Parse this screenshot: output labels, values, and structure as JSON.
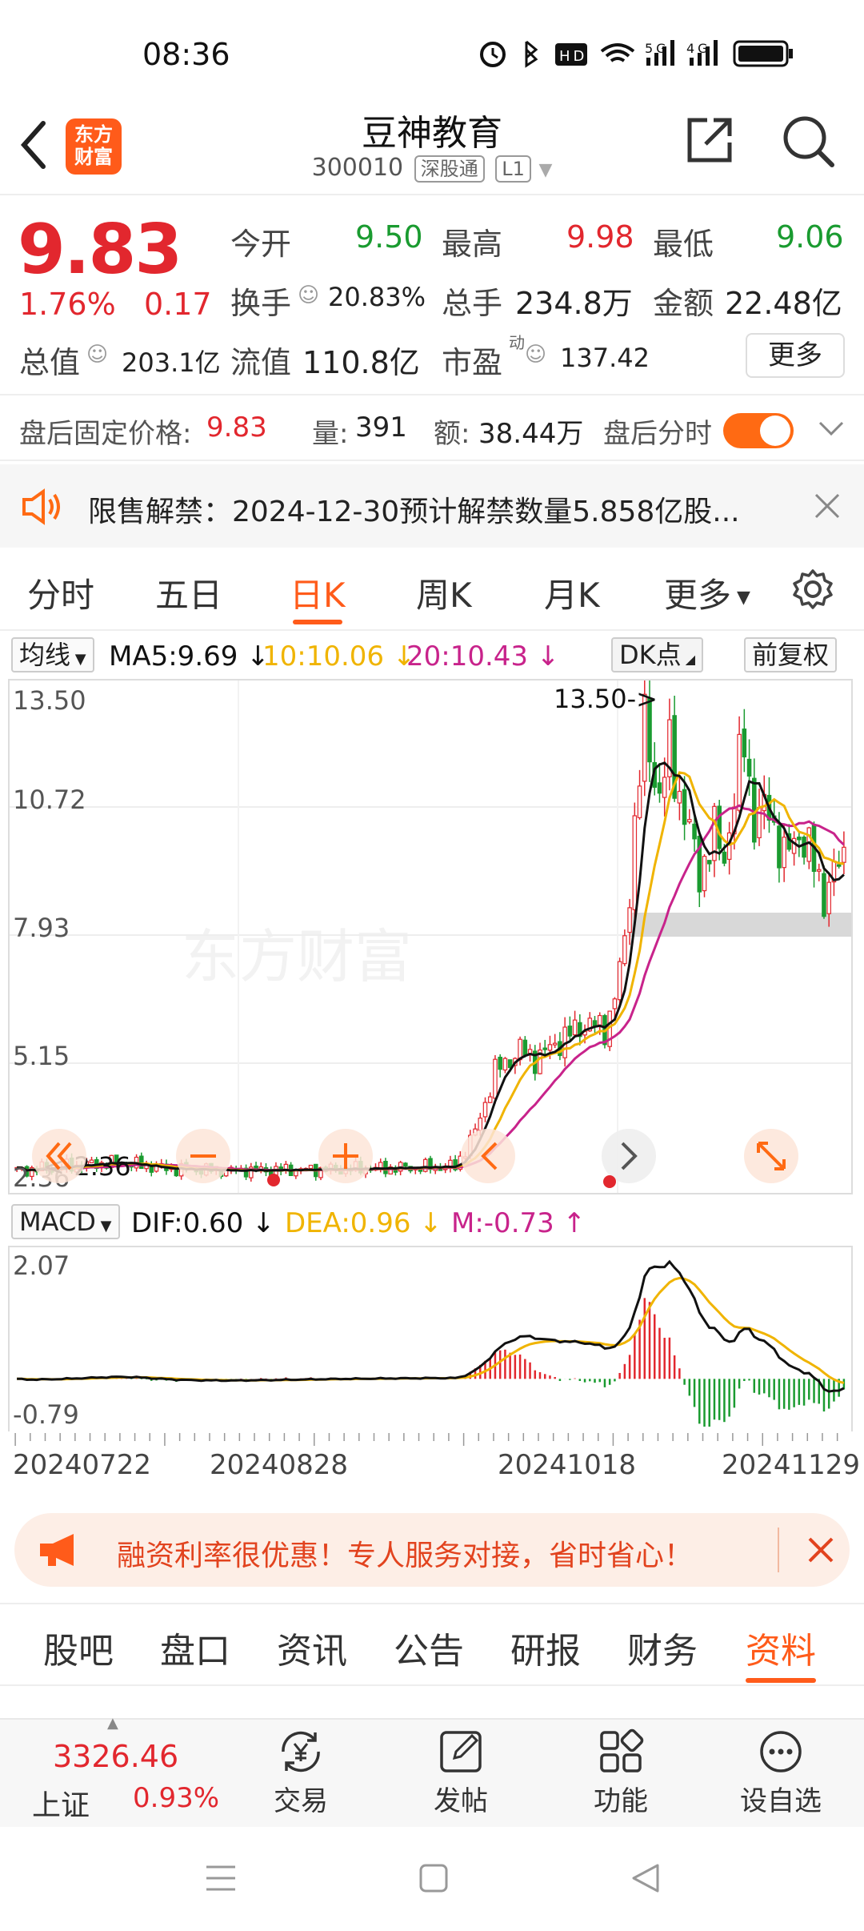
{
  "status_bar": {
    "time": "08:36",
    "icons_text": "⏰ ✱ HD 📶 5G 4G ▮▮▮"
  },
  "header": {
    "logo_text_1": "东方",
    "logo_text_2": "财富",
    "title": "豆神教育",
    "code": "300010",
    "tag_market": "深股通",
    "tag_level": "L1"
  },
  "quote": {
    "price": "9.83",
    "change_pct": "1.76%",
    "change": "0.17",
    "open_label": "今开",
    "open": "9.50",
    "high_label": "最高",
    "high": "9.98",
    "low_label": "最低",
    "low": "9.06",
    "turnover_label": "换手",
    "turnover": "20.83%",
    "volume_label": "总手",
    "volume": "234.8万",
    "amount_label": "金额",
    "amount": "22.48亿",
    "mcap_label": "总值",
    "mcap": "203.1亿",
    "float_label": "流值",
    "float": "110.8亿",
    "pe_label": "市盈",
    "pe_sup": "动",
    "pe": "137.42",
    "more_label": "更多"
  },
  "after_hours": {
    "price_label": "盘后固定价格:",
    "price": "9.83",
    "vol_label": "量:",
    "vol": "391",
    "amt_label": "额:",
    "amt": "38.44万",
    "timeshare_label": "盘后分时"
  },
  "notice": {
    "text": "限售解禁：2024-12-30预计解禁数量5.858亿股..."
  },
  "period_tabs": [
    {
      "label": "分时",
      "active": false
    },
    {
      "label": "五日",
      "active": false
    },
    {
      "label": "日K",
      "active": true
    },
    {
      "label": "周K",
      "active": false
    },
    {
      "label": "月K",
      "active": false
    },
    {
      "label": "更多",
      "active": false
    }
  ],
  "ma_line": {
    "selector": "均线",
    "ma5": "MA5:9.69",
    "ma10": "10:10.06",
    "ma20": "20:10.43",
    "dk": "DK点",
    "adjust": "前复权"
  },
  "kline": {
    "y_ticks": [
      "13.50",
      "10.72",
      "7.93",
      "5.15",
      "2.36"
    ],
    "max_annotation": "13.50->",
    "min_annotation": "<-2.36",
    "watermark": "东方财富",
    "colors": {
      "up": "#e2272e",
      "down": "#1a9b30",
      "ma5": "#111111",
      "ma10": "#f0b400",
      "ma20": "#c8238b"
    }
  },
  "macd_line": {
    "selector": "MACD",
    "dif": "DIF:0.60",
    "dea": "DEA:0.96",
    "m": "M:-0.73"
  },
  "macd_chart": {
    "y_ticks": [
      "2.07",
      "-0.79"
    ]
  },
  "dates": [
    "20240722",
    "20240828",
    "20241018",
    "20241129"
  ],
  "promo": {
    "text": "融资利率很优惠！专人服务对接，省时省心！"
  },
  "info_tabs": [
    {
      "label": "股吧",
      "active": false
    },
    {
      "label": "盘口",
      "active": false
    },
    {
      "label": "资讯",
      "active": false
    },
    {
      "label": "公告",
      "active": false
    },
    {
      "label": "研报",
      "active": false
    },
    {
      "label": "财务",
      "active": false
    },
    {
      "label": "资料",
      "active": true
    }
  ],
  "bottom_bar": {
    "index_value": "3326.46",
    "index_name": "上证",
    "index_pct": "0.93%",
    "items": [
      "交易",
      "发帖",
      "功能",
      "设自选"
    ]
  }
}
